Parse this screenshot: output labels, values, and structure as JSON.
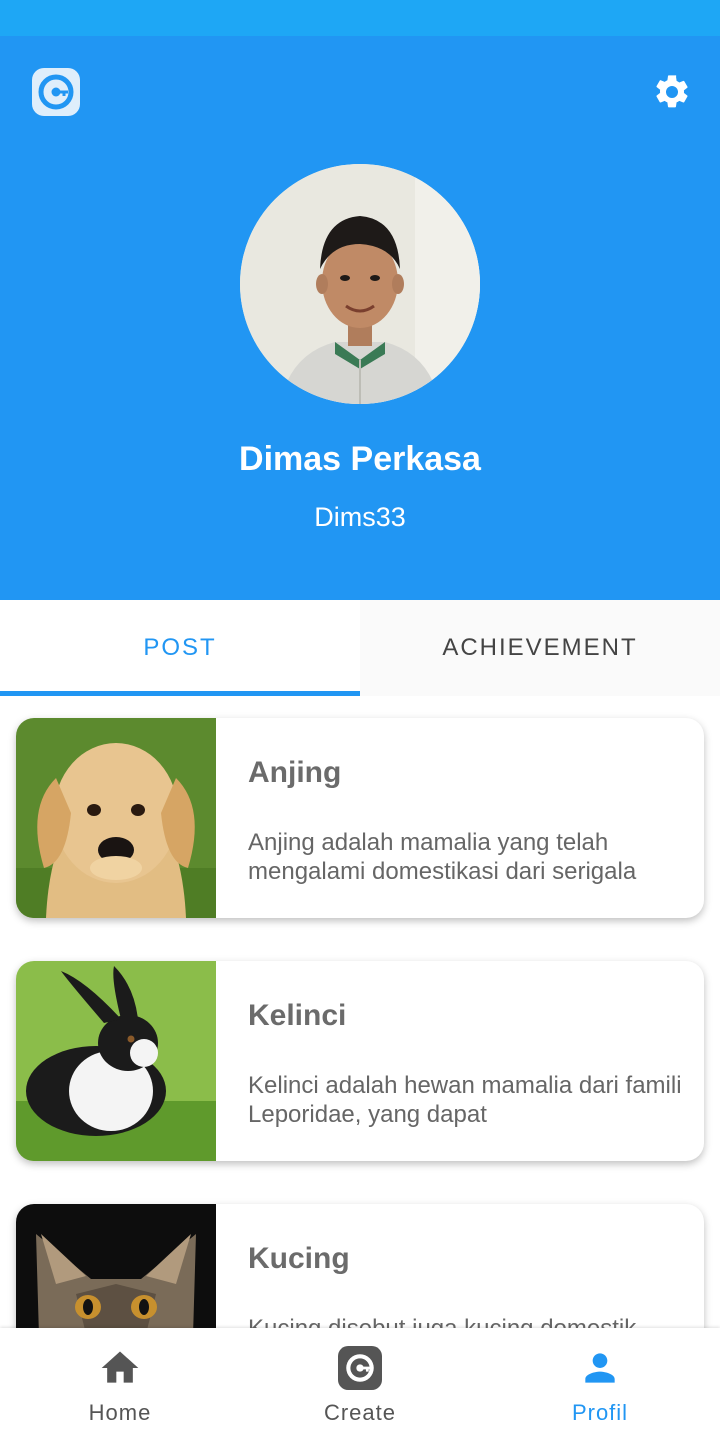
{
  "colors": {
    "primary": "#2196f3",
    "status_bar": "#1ea7f5",
    "text_muted": "#666666",
    "nav_inactive": "#555555"
  },
  "header": {
    "logo_icon": "app-logo-icon",
    "settings_icon": "gear-icon"
  },
  "profile": {
    "name": "Dimas Perkasa",
    "username": "Dims33"
  },
  "tabs": [
    {
      "label": "POST",
      "active": true
    },
    {
      "label": "ACHIEVEMENT",
      "active": false
    }
  ],
  "posts": [
    {
      "title": "Anjing",
      "description": "Anjing adalah mamalia yang telah mengalami domestikasi dari serigala",
      "image": "dog-photo"
    },
    {
      "title": "Kelinci",
      "description": "Kelinci adalah hewan mamalia dari famili Leporidae, yang dapat",
      "image": "rabbit-photo"
    },
    {
      "title": "Kucing",
      "description": "Kucing disebut juga kucing domestik",
      "image": "cat-photo"
    }
  ],
  "bottom_nav": [
    {
      "label": "Home",
      "icon": "home-icon",
      "active": false
    },
    {
      "label": "Create",
      "icon": "create-icon",
      "active": false
    },
    {
      "label": "Profil",
      "icon": "person-icon",
      "active": true
    }
  ]
}
